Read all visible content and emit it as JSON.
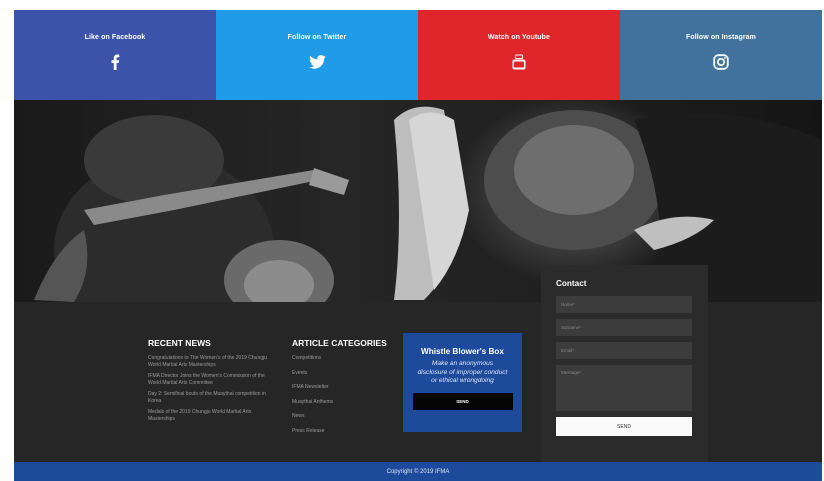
{
  "social": [
    {
      "label": "Like on  Facebook",
      "icon": "facebook-icon",
      "color": "#3b53a8"
    },
    {
      "label": "Follow on Twitter",
      "icon": "twitter-icon",
      "color": "#1f9be7"
    },
    {
      "label": "Watch on Youtube",
      "icon": "youtube-icon",
      "color": "#e1262b"
    },
    {
      "label": "Follow on Instagram",
      "icon": "instagram-icon",
      "color": "#41729e"
    }
  ],
  "recent_news": {
    "title": "RECENT NEWS",
    "items": [
      "Congratulations to The Women's of the 2019 Chungju World Martial Arts Masterships",
      "IFMA Director Joins the Women's Commission of the World Martial Arts Committee",
      "Day 2: Semifinal bouts of the Muaythai competition in Korea",
      "Medals of the 2019 Chungju World Martial Arts Masterships"
    ]
  },
  "article_categories": {
    "title": "ARTICLE CATEGORIES",
    "items": [
      "Competitions",
      "Events",
      "IFMA Newsletter",
      "Muaythai Anthems",
      "News",
      "Press Release"
    ]
  },
  "whistle": {
    "title": "Whistle Blower's Box",
    "description": "Make an anonymous disclosure of improper conduct or ethical wrongdoing",
    "send_label": "SEND"
  },
  "contact": {
    "title": "Contact",
    "name_placeholder": "Name*",
    "surname_placeholder": "Surname*",
    "email_placeholder": "Email*",
    "message_placeholder": "Message*",
    "send_label": "SEND"
  },
  "copyright": "Copyright © 2019 IFMA",
  "colors": {
    "footer_bg": "#262626",
    "accent_blue": "#1e4a9c"
  }
}
